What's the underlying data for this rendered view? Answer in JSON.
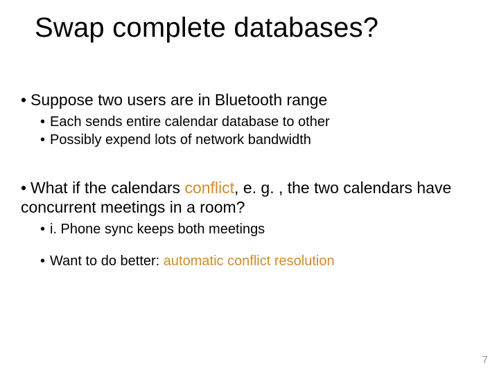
{
  "title": "Swap complete databases?",
  "bullets": {
    "p1": "Suppose two users are in Bluetooth range",
    "p1a": "Each sends entire calendar database to other",
    "p1b": "Possibly expend lots of network bandwidth",
    "p2_pre": "What if the calendars ",
    "p2_conflict": "conflict",
    "p2_post": ", e. g. , the two calendars have concurrent meetings in a room?",
    "p2a": "i. Phone sync keeps both meetings",
    "p2b_pre": "Want to do better: ",
    "p2b_acr": "automatic conflict resolution"
  },
  "page_number": "7"
}
